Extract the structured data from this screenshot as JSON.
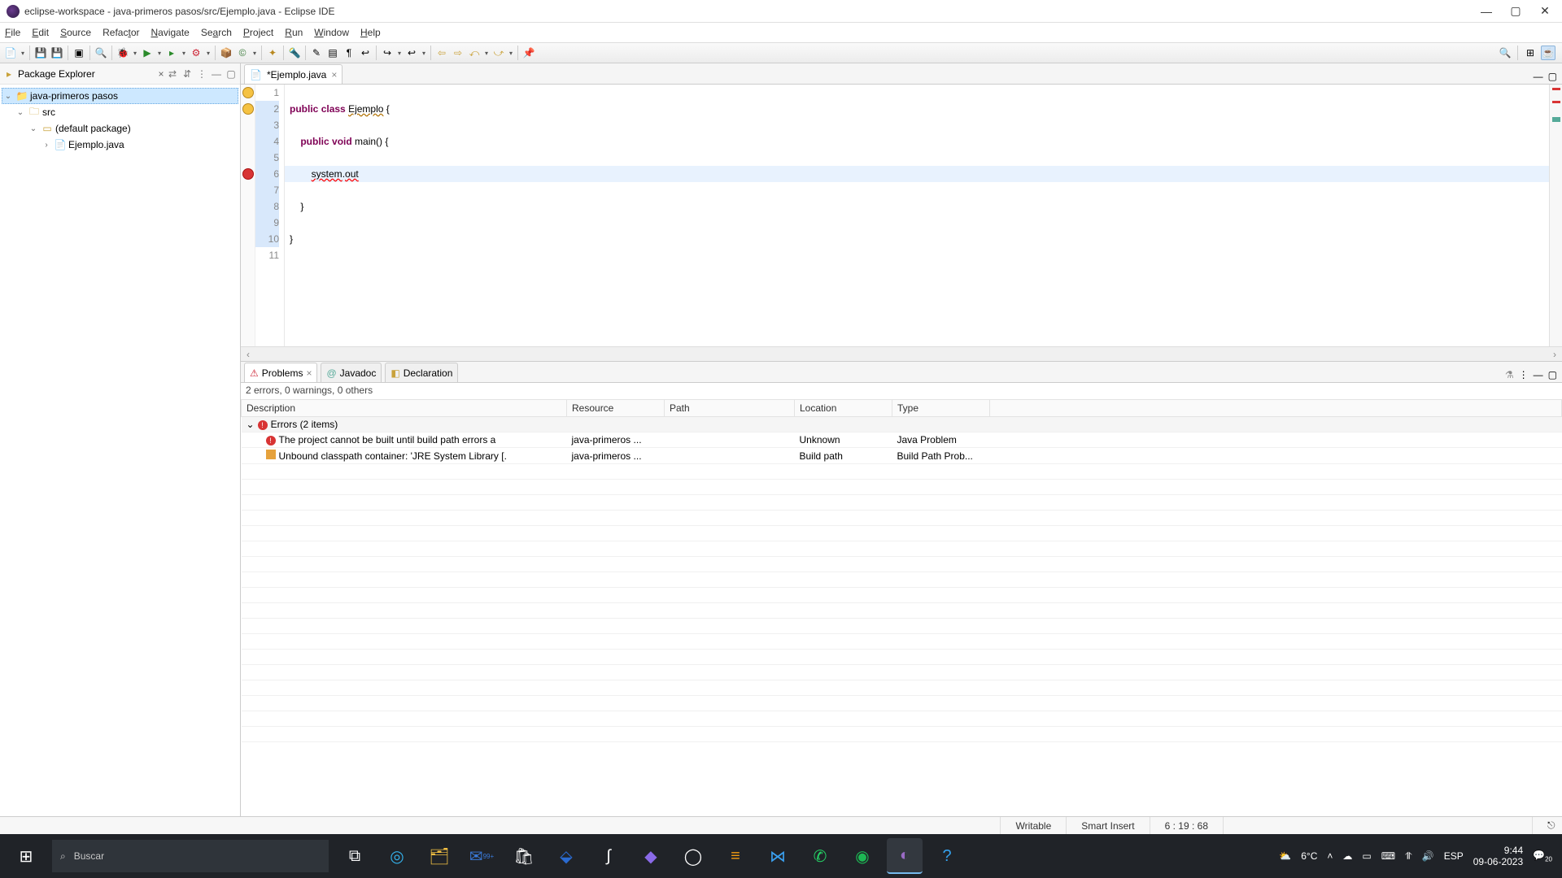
{
  "window": {
    "title": "eclipse-workspace - java-primeros pasos/src/Ejemplo.java - Eclipse IDE"
  },
  "menu": [
    "File",
    "Edit",
    "Source",
    "Refactor",
    "Navigate",
    "Search",
    "Project",
    "Run",
    "Window",
    "Help"
  ],
  "package_explorer": {
    "title": "Package Explorer",
    "project": "java-primeros pasos",
    "src": "src",
    "pkg": "(default package)",
    "file": "Ejemplo.java"
  },
  "editor": {
    "tab_label": "*Ejemplo.java",
    "lines": [
      {
        "n": 1,
        "html": ""
      },
      {
        "n": 2,
        "html": "<span class='kw'>public</span> <span class='kw'>class</span> <span class='squig'>Ejemplo</span> {"
      },
      {
        "n": 3,
        "html": ""
      },
      {
        "n": 4,
        "html": "    <span class='kw'>public</span> <span class='kw'>void</span> main() {"
      },
      {
        "n": 5,
        "html": ""
      },
      {
        "n": 6,
        "html": "        <span class='err'>system</span>.<span class='err'>out</span>"
      },
      {
        "n": 7,
        "html": ""
      },
      {
        "n": 8,
        "html": "    }"
      },
      {
        "n": 9,
        "html": ""
      },
      {
        "n": 10,
        "html": "}"
      },
      {
        "n": 11,
        "html": ""
      }
    ],
    "active_line_index": 5
  },
  "bottom": {
    "tabs": [
      "Problems",
      "Javadoc",
      "Declaration"
    ],
    "summary": "2 errors, 0 warnings, 0 others",
    "columns": [
      "Description",
      "Resource",
      "Path",
      "Location",
      "Type"
    ],
    "group": "Errors (2 items)",
    "rows": [
      {
        "desc": "The project cannot be built until build path errors a",
        "res": "java-primeros ...",
        "path": "",
        "loc": "Unknown",
        "type": "Java Problem",
        "icon": "err"
      },
      {
        "desc": "Unbound classpath container: 'JRE System Library [.",
        "res": "java-primeros ...",
        "path": "",
        "loc": "Build path",
        "type": "Build Path Prob...",
        "icon": "warn"
      }
    ]
  },
  "status": {
    "writable": "Writable",
    "insert": "Smart Insert",
    "pos": "6 : 19 : 68"
  },
  "taskbar": {
    "search_placeholder": "Buscar",
    "weather": "6°C",
    "lang": "ESP",
    "time": "9:44",
    "date": "09-06-2023"
  }
}
